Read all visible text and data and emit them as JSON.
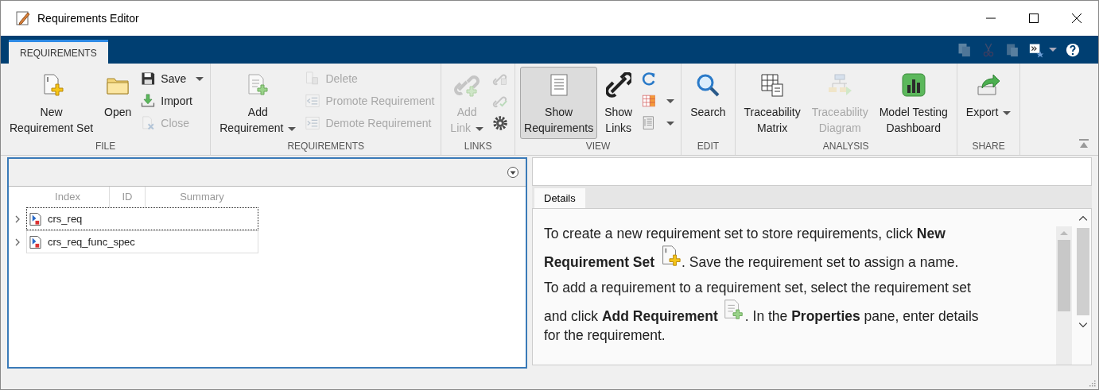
{
  "window": {
    "title": "Requirements Editor"
  },
  "toolstrip_tabs": [
    {
      "label": "REQUIREMENTS",
      "selected": true
    }
  ],
  "quick_access": [
    {
      "disabled": true
    },
    {
      "disabled": true
    },
    {
      "disabled": true
    },
    {
      "disabled": false,
      "dropdown": true
    },
    {
      "disabled": false
    }
  ],
  "ribbon": [
    {
      "label": "FILE",
      "columns": [
        {
          "kind": "large",
          "items": [
            {
              "label": "New\nRequirement Set",
              "disabled": false
            }
          ]
        },
        {
          "kind": "large",
          "items": [
            {
              "label": "Open",
              "disabled": false
            }
          ]
        },
        {
          "kind": "stack",
          "items": [
            {
              "label": "Save",
              "disabled": false,
              "dropdown": true
            },
            {
              "label": "Import",
              "disabled": false
            },
            {
              "label": "Close",
              "disabled": true
            }
          ]
        }
      ]
    },
    {
      "label": "REQUIREMENTS",
      "columns": [
        {
          "kind": "large",
          "items": [
            {
              "label": "Add\nRequirement",
              "disabled": false,
              "dropdown": true
            }
          ]
        },
        {
          "kind": "stack",
          "items": [
            {
              "label": "Delete",
              "disabled": true
            },
            {
              "label": "Promote Requirement",
              "disabled": true
            },
            {
              "label": "Demote Requirement",
              "disabled": true
            }
          ]
        }
      ]
    },
    {
      "label": "LINKS",
      "columns": [
        {
          "kind": "large",
          "items": [
            {
              "label": "Add\nLink",
              "disabled": true,
              "dropdown": true
            }
          ]
        },
        {
          "kind": "stack",
          "items": [
            {
              "disabled": true
            },
            {
              "disabled": true
            },
            {
              "disabled": false
            }
          ]
        }
      ]
    },
    {
      "label": "VIEW",
      "columns": [
        {
          "kind": "large",
          "items": [
            {
              "label": "Show\nRequirements",
              "disabled": false,
              "selected": true
            }
          ]
        },
        {
          "kind": "large",
          "items": [
            {
              "label": "Show\nLinks",
              "disabled": false,
              "selected": false
            }
          ]
        },
        {
          "kind": "stack",
          "items": [
            {
              "disabled": false
            },
            {
              "disabled": false,
              "dropdown": true
            },
            {
              "disabled": false,
              "dropdown": true
            }
          ]
        }
      ]
    },
    {
      "label": "EDIT",
      "columns": [
        {
          "kind": "large",
          "items": [
            {
              "label": "Search",
              "disabled": false
            }
          ]
        }
      ]
    },
    {
      "label": "ANALYSIS",
      "columns": [
        {
          "kind": "large",
          "items": [
            {
              "label": "Traceability\nMatrix",
              "disabled": false
            }
          ]
        },
        {
          "kind": "large",
          "items": [
            {
              "label": "Traceability\nDiagram",
              "disabled": true
            }
          ]
        },
        {
          "kind": "large",
          "items": [
            {
              "label": "Model Testing\nDashboard",
              "disabled": false
            }
          ]
        }
      ]
    },
    {
      "label": "SHARE",
      "columns": [
        {
          "kind": "large",
          "items": [
            {
              "label": "Export",
              "disabled": false,
              "dropdown": true
            }
          ]
        }
      ]
    }
  ],
  "table": {
    "columns": [
      "Index",
      "ID",
      "Summary"
    ],
    "rows": [
      {
        "name": "crs_req",
        "expanded": false,
        "focused": true
      },
      {
        "name": "crs_req_func_spec",
        "expanded": false,
        "focused": false
      }
    ]
  },
  "details": {
    "tabs": [
      {
        "label": "Details",
        "selected": true
      }
    ],
    "paragraphs": [
      {
        "lines": [
          {
            "kind": "text",
            "text": "To create a new requirement set to store requirements, click **New**"
          },
          {
            "kind": "icon",
            "before": "**Requirement Set**",
            "after": ". Save the requirement set to assign a name."
          }
        ]
      },
      {
        "lines": [
          {
            "kind": "text",
            "text": "To add a requirement to a requirement set, select the requirement set"
          },
          {
            "kind": "icon",
            "before": "and click **Add Requirement**",
            "after": ". In the **Properties** pane, enter details"
          },
          {
            "kind": "text",
            "text": "for the requirement."
          }
        ]
      }
    ]
  }
}
